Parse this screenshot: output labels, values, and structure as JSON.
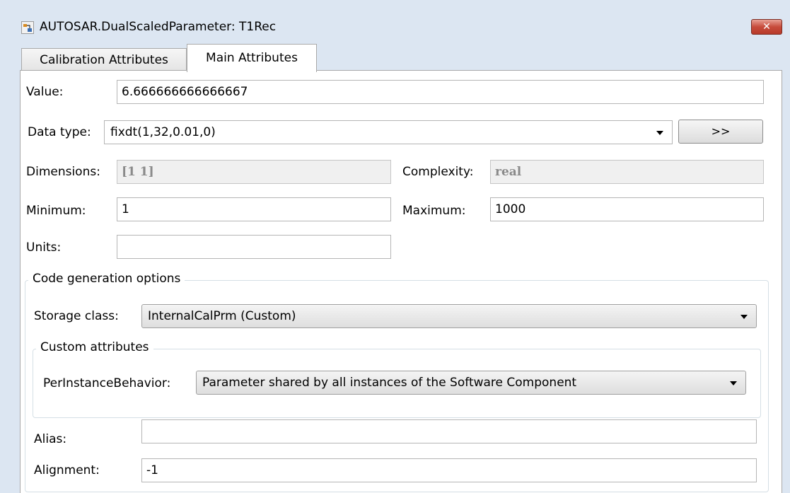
{
  "window": {
    "title": "AUTOSAR.DualScaledParameter: T1Rec",
    "close_icon": "close-icon",
    "app_icon": "simulink-icon"
  },
  "tabs": [
    {
      "label": "Calibration Attributes",
      "active": false
    },
    {
      "label": "Main Attributes",
      "active": true
    }
  ],
  "main": {
    "value_label": "Value:",
    "value": "6.666666666666667",
    "datatype_label": "Data type:",
    "datatype": "fixdt(1,32,0.01,0)",
    "datatype_button": ">>",
    "dimensions_label": "Dimensions:",
    "dimensions": "[1 1]",
    "complexity_label": "Complexity:",
    "complexity": "real",
    "minimum_label": "Minimum:",
    "minimum": "1",
    "maximum_label": "Maximum:",
    "maximum": "1000",
    "units_label": "Units:",
    "units": ""
  },
  "codegen": {
    "legend": "Code generation options",
    "storage_label": "Storage class:",
    "storage": "InternalCalPrm (Custom)",
    "custom": {
      "legend": "Custom attributes",
      "per_instance_label": "PerInstanceBehavior:",
      "per_instance": "Parameter shared by all instances of the Software Component"
    },
    "alias_label": "Alias:",
    "alias": "",
    "alignment_label": "Alignment:",
    "alignment": "-1"
  }
}
